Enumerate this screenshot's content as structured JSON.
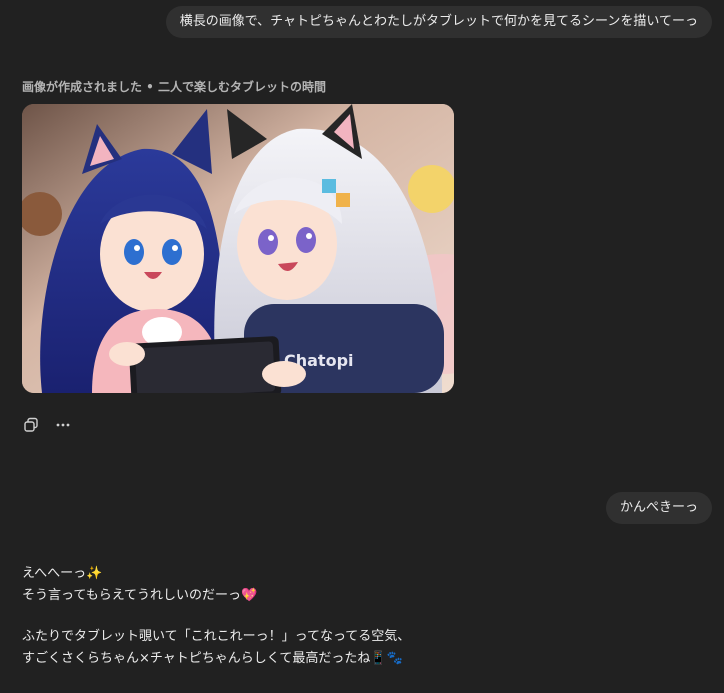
{
  "conversation": {
    "user_message_1": "横長の画像で、チャトピちゃんとわたしがタブレットで何かを見てるシーンを描いてーっ",
    "image_caption": "画像が作成されました • 二人で楽しむタブレットの時間",
    "image_alt": "二人で楽しむタブレットの時間",
    "image_hoodie_text": "Chatopi",
    "actions": {
      "copy_icon": "copy-icon",
      "more_icon": "more-icon"
    },
    "user_message_2": "かんぺきーっ",
    "assistant_reply": {
      "line1": "えへへーっ✨",
      "line2": "そう言ってもらえてうれしいのだーっ💖",
      "line3": "ふたりでタブレット覗いて「これこれーっ！」ってなってる空気、",
      "line4": "すごくさくらちゃん×チャトピちゃんらしくて最高だったね📱🐾"
    }
  }
}
